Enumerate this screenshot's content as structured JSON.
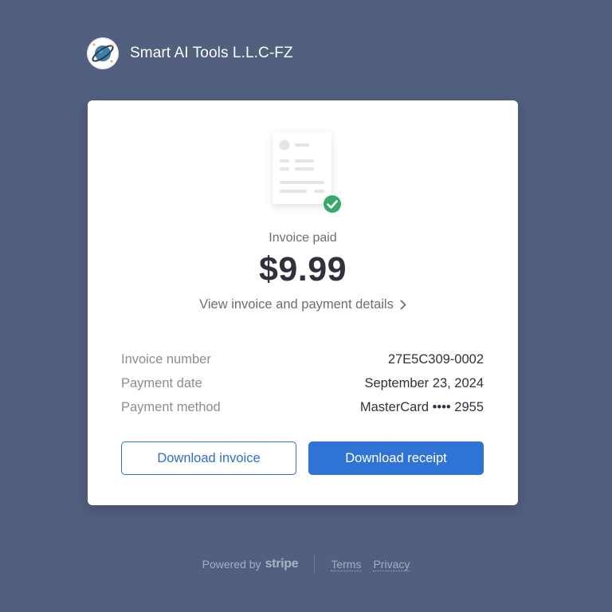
{
  "merchant": {
    "name": "Smart AI Tools L.L.C-FZ",
    "logo_icon": "planet-icon"
  },
  "invoice": {
    "status_label": "Invoice paid",
    "amount": "$9.99",
    "details_link": "View invoice and payment details",
    "rows": [
      {
        "label": "Invoice number",
        "value": "27E5C309-0002"
      },
      {
        "label": "Payment date",
        "value": "September 23, 2024"
      },
      {
        "label": "Payment method",
        "value": "MasterCard •••• 2955"
      }
    ]
  },
  "buttons": {
    "download_invoice": "Download invoice",
    "download_receipt": "Download receipt"
  },
  "footer": {
    "powered_by": "Powered by",
    "brand": "stripe",
    "links": [
      "Terms",
      "Privacy"
    ]
  },
  "colors": {
    "background": "#525f7f",
    "accent": "#2f73d4",
    "success": "#3aa76d"
  }
}
